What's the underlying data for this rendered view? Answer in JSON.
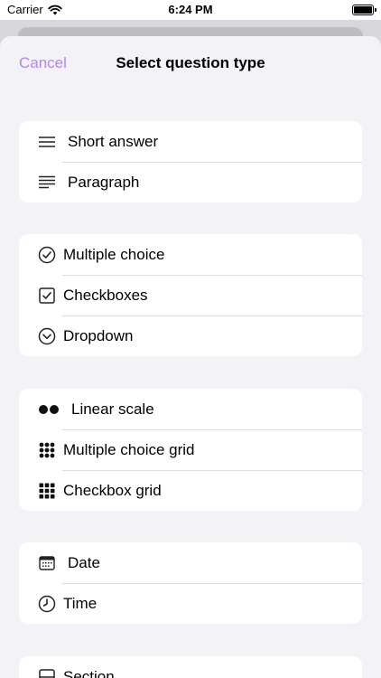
{
  "status_bar": {
    "carrier": "Carrier",
    "time": "6:24 PM"
  },
  "nav": {
    "cancel_label": "Cancel",
    "title": "Select question type"
  },
  "groups": [
    {
      "items": [
        {
          "label": "Short answer",
          "icon": "short-answer-lines-icon"
        },
        {
          "label": "Paragraph",
          "icon": "paragraph-lines-icon"
        }
      ]
    },
    {
      "items": [
        {
          "label": "Multiple choice",
          "icon": "checkmark-circle-icon"
        },
        {
          "label": "Checkboxes",
          "icon": "checkmark-square-icon"
        },
        {
          "label": "Dropdown",
          "icon": "chevron-down-circle-icon"
        }
      ]
    },
    {
      "items": [
        {
          "label": "Linear scale",
          "icon": "two-dots-icon"
        },
        {
          "label": "Multiple choice grid",
          "icon": "dot-grid-icon"
        },
        {
          "label": "Checkbox grid",
          "icon": "square-grid-icon"
        }
      ]
    },
    {
      "items": [
        {
          "label": "Date",
          "icon": "calendar-icon"
        },
        {
          "label": "Time",
          "icon": "clock-icon"
        }
      ]
    },
    {
      "items": [
        {
          "label": "Section",
          "icon": "section-icon"
        }
      ]
    }
  ],
  "colors": {
    "accent": "#b388eb",
    "sheet_bg": "#f2f2f7",
    "card_bg": "#ffffff"
  }
}
